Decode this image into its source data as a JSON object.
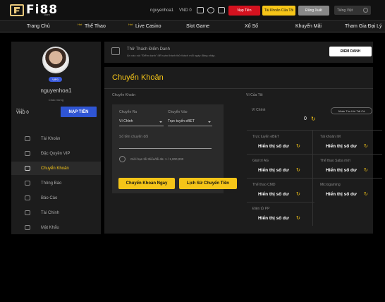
{
  "header": {
    "logo": "Fi88",
    "logo_sub": ".com",
    "username": "nguyenhoa1",
    "balance": "VND 0",
    "deposit": "Nạp Tiền",
    "register": "Tài Khoản Của Tôi",
    "logout": "Đăng Xuất",
    "language": "Tiếng Việt"
  },
  "nav": {
    "hot": "Hot",
    "items": [
      "Trang Chủ",
      "Thể Thao",
      "Live Casino",
      "Slot Game",
      "Xổ Số",
      "Khuyến Mãi",
      "Tham Gia Đại Lý"
    ]
  },
  "profile": {
    "vip": "VIP0",
    "name": "nguyenhoa1",
    "greeting": "Chào mừng",
    "balance_label": "Số dư",
    "balance": "VND 0",
    "deposit": "NẠP TIỀN"
  },
  "menu": [
    {
      "label": "Tài Khoản",
      "icon": "user-icon"
    },
    {
      "label": "Đặc Quyền VIP",
      "icon": "crown-icon"
    },
    {
      "label": "Chuyển Khoản",
      "icon": "transfer-icon",
      "active": true
    },
    {
      "label": "Thông Báo",
      "icon": "bell-icon"
    },
    {
      "label": "Báo Cáo",
      "icon": "report-icon"
    },
    {
      "label": "Tài Chính",
      "icon": "wallet-icon"
    },
    {
      "label": "Mật Khẩu",
      "icon": "lock-icon"
    }
  ],
  "notice": {
    "title": "Thử Thách Điểm Danh",
    "text": "Ấn vào nút \"Điểm danh\" để hoàn thành thử thách mỗi ngày đăng nhập.",
    "button": "ĐIỂM DANH"
  },
  "transfer": {
    "title": "Chuyển Khoản",
    "section": "Chuyển Khoản",
    "from_label": "Chuyển Ra",
    "from_value": "Ví Chính",
    "to_label": "Chuyển Vào",
    "to_value": "Trực tuyến eBET",
    "amount_placeholder": "Số tiền chuyển đổi",
    "limit": "Giới hạn tối thiểu/tối đa: 1 / 1,000,000",
    "submit": "Chuyển Khoản Ngay",
    "history": "Lịch Sử Chuyển Tiền"
  },
  "wallet": {
    "title": "Ví Của Tôi",
    "main_label": "Ví Chính",
    "main_value": "0",
    "retrieve": "Nhấn Thu Hồi Tất Cả",
    "show": "Hiển thị số dư",
    "accounts": [
      "Trực tuyến eBET",
      "Tài khoản IM",
      "Giải trí AG",
      "Thể thao Saba mới",
      "Thể thao CMD",
      "Microgaming",
      "Điện tử PP"
    ]
  }
}
